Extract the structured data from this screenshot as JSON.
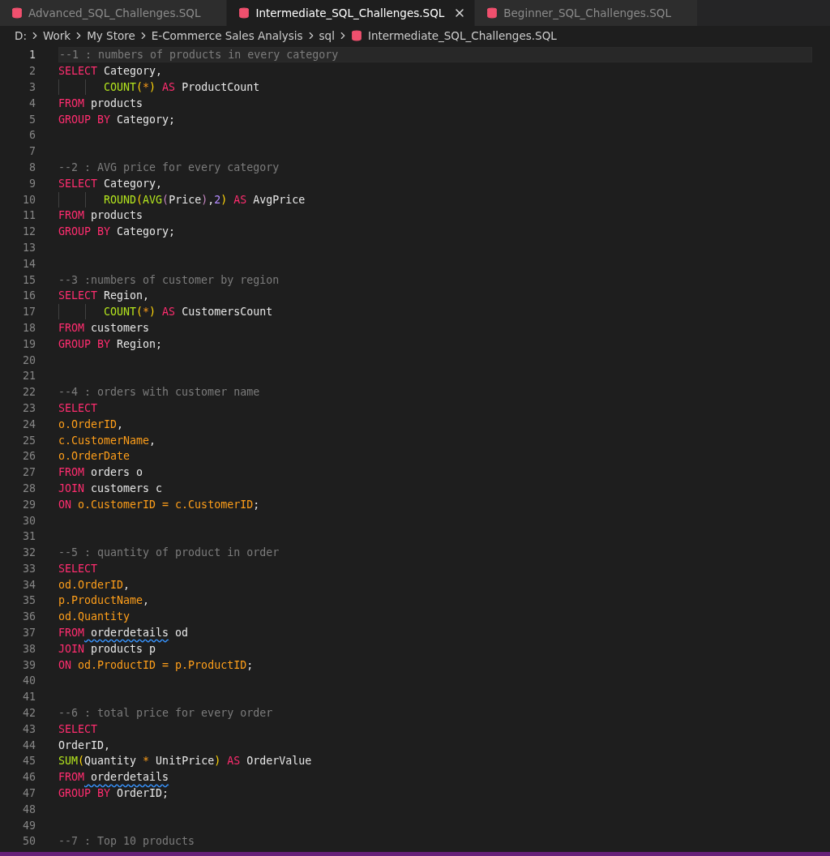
{
  "tabs": [
    {
      "label": "Advanced_SQL_Challenges.SQL",
      "selected": false
    },
    {
      "label": "Intermediate_SQL_Challenges.SQL",
      "selected": true
    },
    {
      "label": "Beginner_SQL_Challenges.SQL",
      "selected": false
    }
  ],
  "breadcrumb": {
    "folders": [
      "D:",
      "Work",
      "My Store",
      "E-Commerce Sales Analysis",
      "sql"
    ],
    "file": "Intermediate_SQL_Challenges.SQL"
  },
  "editor": {
    "lines": [
      {
        "number": "1",
        "selected": true,
        "indented": false,
        "tokens": [
          {
            "kind": "comment",
            "text": "--1 : numbers of products in every category"
          }
        ]
      },
      {
        "number": "2",
        "selected": false,
        "indented": false,
        "tokens": [
          {
            "kind": "keyword",
            "text": "SELECT"
          },
          {
            "kind": "plain",
            "text": " Category,"
          }
        ]
      },
      {
        "number": "3",
        "selected": false,
        "indented": true,
        "tokens": [
          {
            "kind": "function",
            "text": "COUNT"
          },
          {
            "kind": "bracket",
            "text": "("
          },
          {
            "kind": "operator",
            "text": "*"
          },
          {
            "kind": "bracket",
            "text": ")"
          },
          {
            "kind": "keyword",
            "text": " AS"
          },
          {
            "kind": "plain",
            "text": " ProductCount"
          }
        ]
      },
      {
        "number": "4",
        "selected": false,
        "indented": false,
        "tokens": [
          {
            "kind": "keyword",
            "text": "FROM"
          },
          {
            "kind": "plain",
            "text": " products"
          }
        ]
      },
      {
        "number": "5",
        "selected": false,
        "indented": false,
        "tokens": [
          {
            "kind": "keyword",
            "text": "GROUP BY"
          },
          {
            "kind": "plain",
            "text": " Category;"
          }
        ]
      },
      {
        "number": "6",
        "selected": false,
        "indented": false
      },
      {
        "number": "7",
        "selected": false,
        "indented": false
      },
      {
        "number": "8",
        "selected": false,
        "indented": false,
        "tokens": [
          {
            "kind": "comment",
            "text": "--2 : AVG price for every category"
          }
        ]
      },
      {
        "number": "9",
        "selected": false,
        "indented": false,
        "tokens": [
          {
            "kind": "keyword",
            "text": "SELECT"
          },
          {
            "kind": "plain",
            "text": " Category,"
          }
        ]
      },
      {
        "number": "10",
        "selected": false,
        "indented": true,
        "tokens": [
          {
            "kind": "function",
            "text": "ROUND"
          },
          {
            "kind": "bracket",
            "text": "("
          },
          {
            "kind": "function",
            "text": "AVG"
          },
          {
            "kind": "bracket2",
            "text": "("
          },
          {
            "kind": "plain",
            "text": "Price"
          },
          {
            "kind": "bracket2",
            "text": ")"
          },
          {
            "kind": "plain",
            "text": ","
          },
          {
            "kind": "number",
            "text": "2"
          },
          {
            "kind": "bracket",
            "text": ")"
          },
          {
            "kind": "keyword",
            "text": " AS"
          },
          {
            "kind": "plain",
            "text": " AvgPrice"
          }
        ]
      },
      {
        "number": "11",
        "selected": false,
        "indented": false,
        "tokens": [
          {
            "kind": "keyword",
            "text": "FROM"
          },
          {
            "kind": "plain",
            "text": " products"
          }
        ]
      },
      {
        "number": "12",
        "selected": false,
        "indented": false,
        "tokens": [
          {
            "kind": "keyword",
            "text": "GROUP BY"
          },
          {
            "kind": "plain",
            "text": " Category;"
          }
        ]
      },
      {
        "number": "13",
        "selected": false,
        "indented": false
      },
      {
        "number": "14",
        "selected": false,
        "indented": false
      },
      {
        "number": "15",
        "selected": false,
        "indented": false,
        "tokens": [
          {
            "kind": "comment",
            "text": "--3 :numbers of customer by region"
          }
        ]
      },
      {
        "number": "16",
        "selected": false,
        "indented": false,
        "tokens": [
          {
            "kind": "keyword",
            "text": "SELECT"
          },
          {
            "kind": "plain",
            "text": " Region,"
          }
        ]
      },
      {
        "number": "17",
        "selected": false,
        "indented": true,
        "tokens": [
          {
            "kind": "function",
            "text": "COUNT"
          },
          {
            "kind": "bracket",
            "text": "("
          },
          {
            "kind": "operator",
            "text": "*"
          },
          {
            "kind": "bracket",
            "text": ")"
          },
          {
            "kind": "keyword",
            "text": " AS"
          },
          {
            "kind": "plain",
            "text": " CustomersCount"
          }
        ]
      },
      {
        "number": "18",
        "selected": false,
        "indented": false,
        "tokens": [
          {
            "kind": "keyword",
            "text": "FROM"
          },
          {
            "kind": "plain",
            "text": " customers"
          }
        ]
      },
      {
        "number": "19",
        "selected": false,
        "indented": false,
        "tokens": [
          {
            "kind": "keyword",
            "text": "GROUP BY"
          },
          {
            "kind": "plain",
            "text": " Region;"
          }
        ]
      },
      {
        "number": "20",
        "selected": false,
        "indented": false
      },
      {
        "number": "21",
        "selected": false,
        "indented": false
      },
      {
        "number": "22",
        "selected": false,
        "indented": false,
        "tokens": [
          {
            "kind": "comment",
            "text": "--4 : orders with customer name"
          }
        ]
      },
      {
        "number": "23",
        "selected": false,
        "indented": false,
        "tokens": [
          {
            "kind": "keyword",
            "text": "SELECT"
          }
        ]
      },
      {
        "number": "24",
        "selected": false,
        "indented": false,
        "tokens": [
          {
            "kind": "field",
            "text": "o.OrderID"
          },
          {
            "kind": "plain",
            "text": ","
          }
        ]
      },
      {
        "number": "25",
        "selected": false,
        "indented": false,
        "tokens": [
          {
            "kind": "field",
            "text": "c.CustomerName"
          },
          {
            "kind": "plain",
            "text": ","
          }
        ]
      },
      {
        "number": "26",
        "selected": false,
        "indented": false,
        "tokens": [
          {
            "kind": "field",
            "text": "o.OrderDate"
          }
        ]
      },
      {
        "number": "27",
        "selected": false,
        "indented": false,
        "tokens": [
          {
            "kind": "keyword",
            "text": "FROM"
          },
          {
            "kind": "plain",
            "text": " orders o"
          }
        ]
      },
      {
        "number": "28",
        "selected": false,
        "indented": false,
        "tokens": [
          {
            "kind": "keyword",
            "text": "JOIN"
          },
          {
            "kind": "plain",
            "text": " customers c"
          }
        ]
      },
      {
        "number": "29",
        "selected": false,
        "indented": false,
        "tokens": [
          {
            "kind": "keyword",
            "text": "ON"
          },
          {
            "kind": "field",
            "text": " o.CustomerID = c.CustomerID"
          },
          {
            "kind": "plain",
            "text": ";"
          }
        ]
      },
      {
        "number": "30",
        "selected": false,
        "indented": false
      },
      {
        "number": "31",
        "selected": false,
        "indented": false
      },
      {
        "number": "32",
        "selected": false,
        "indented": false,
        "tokens": [
          {
            "kind": "comment",
            "text": "--5 : quantity of product in order"
          }
        ]
      },
      {
        "number": "33",
        "selected": false,
        "indented": false,
        "tokens": [
          {
            "kind": "keyword",
            "text": "SELECT"
          }
        ]
      },
      {
        "number": "34",
        "selected": false,
        "indented": false,
        "tokens": [
          {
            "kind": "field",
            "text": "od.OrderID"
          },
          {
            "kind": "plain",
            "text": ","
          }
        ]
      },
      {
        "number": "35",
        "selected": false,
        "indented": false,
        "tokens": [
          {
            "kind": "field",
            "text": "p.ProductName"
          },
          {
            "kind": "plain",
            "text": ","
          }
        ]
      },
      {
        "number": "36",
        "selected": false,
        "indented": false,
        "tokens": [
          {
            "kind": "field",
            "text": "od.Quantity"
          }
        ]
      },
      {
        "number": "37",
        "selected": false,
        "indented": false,
        "tokens": [
          {
            "kind": "keyword",
            "text": "FROM"
          },
          {
            "kind": "plain",
            "text": " orderdetails",
            "warning": true
          },
          {
            "kind": "plain",
            "text": " od"
          }
        ]
      },
      {
        "number": "38",
        "selected": false,
        "indented": false,
        "tokens": [
          {
            "kind": "keyword",
            "text": "JOIN"
          },
          {
            "kind": "plain",
            "text": " products p"
          }
        ]
      },
      {
        "number": "39",
        "selected": false,
        "indented": false,
        "tokens": [
          {
            "kind": "keyword",
            "text": "ON"
          },
          {
            "kind": "field",
            "text": " od.ProductID = p.ProductID"
          },
          {
            "kind": "plain",
            "text": ";"
          }
        ]
      },
      {
        "number": "40",
        "selected": false,
        "indented": false
      },
      {
        "number": "41",
        "selected": false,
        "indented": false
      },
      {
        "number": "42",
        "selected": false,
        "indented": false,
        "tokens": [
          {
            "kind": "comment",
            "text": "--6 : total price for every order"
          }
        ]
      },
      {
        "number": "43",
        "selected": false,
        "indented": false,
        "tokens": [
          {
            "kind": "keyword",
            "text": "SELECT"
          }
        ]
      },
      {
        "number": "44",
        "selected": false,
        "indented": false,
        "tokens": [
          {
            "kind": "plain",
            "text": "OrderID,"
          }
        ]
      },
      {
        "number": "45",
        "selected": false,
        "indented": false,
        "tokens": [
          {
            "kind": "function",
            "text": "SUM"
          },
          {
            "kind": "bracket",
            "text": "("
          },
          {
            "kind": "plain",
            "text": "Quantity"
          },
          {
            "kind": "operator",
            "text": " *"
          },
          {
            "kind": "plain",
            "text": " UnitPrice"
          },
          {
            "kind": "bracket",
            "text": ")"
          },
          {
            "kind": "keyword",
            "text": " AS"
          },
          {
            "kind": "plain",
            "text": " OrderValue"
          }
        ]
      },
      {
        "number": "46",
        "selected": false,
        "indented": false,
        "tokens": [
          {
            "kind": "keyword",
            "text": "FROM"
          },
          {
            "kind": "plain",
            "text": " orderdetails",
            "warning": true
          }
        ]
      },
      {
        "number": "47",
        "selected": false,
        "indented": false,
        "tokens": [
          {
            "kind": "keyword",
            "text": "GROUP BY"
          },
          {
            "kind": "plain",
            "text": " OrderID;"
          }
        ]
      },
      {
        "number": "48",
        "selected": false,
        "indented": false
      },
      {
        "number": "49",
        "selected": false,
        "indented": false
      },
      {
        "number": "50",
        "selected": false,
        "indented": false,
        "tokens": [
          {
            "kind": "comment",
            "text": "--7 : Top 10 products"
          }
        ]
      }
    ]
  }
}
